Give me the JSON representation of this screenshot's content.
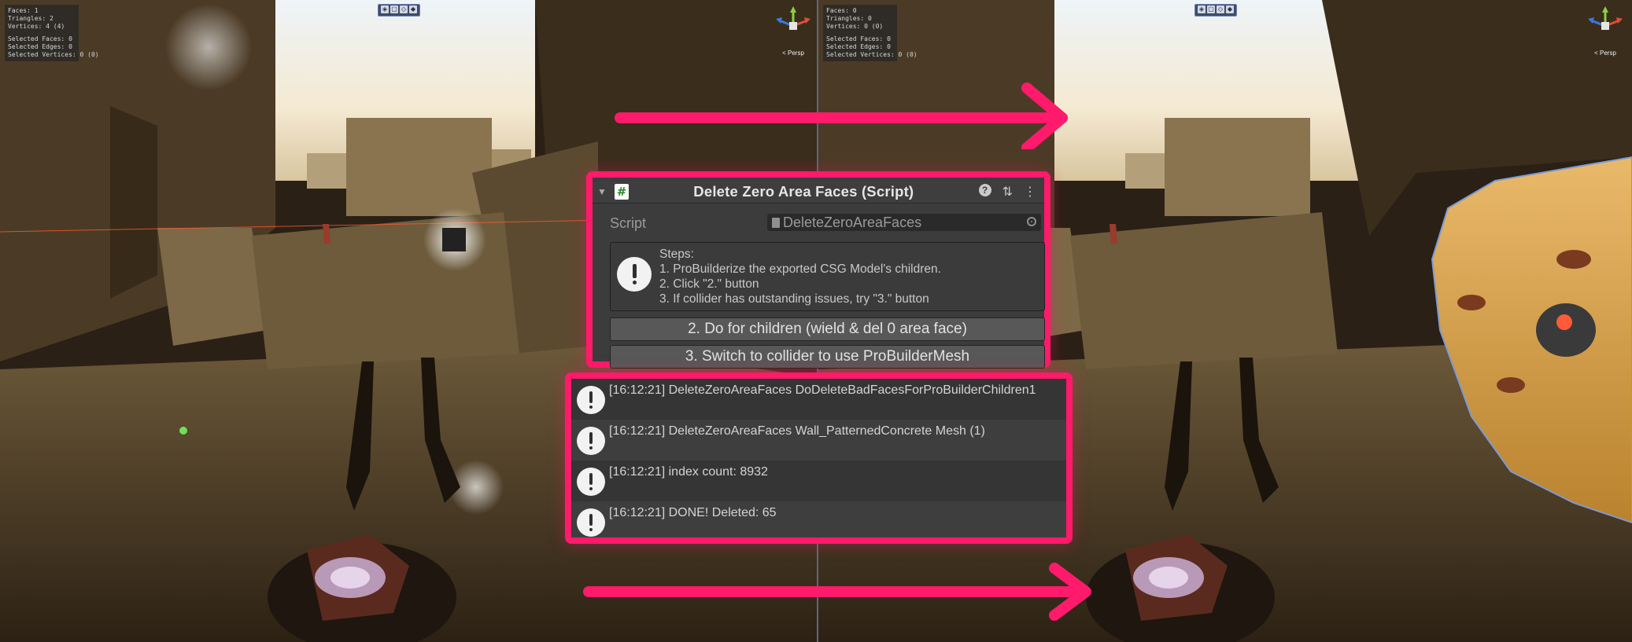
{
  "left_view": {
    "stats": {
      "faces": "Faces: 1",
      "triangles": "Triangles: 2",
      "vertices": "Vertices: 4 (4)",
      "selected_faces": "Selected Faces: 0",
      "selected_edges": "Selected Edges: 0",
      "selected_vertices": "Selected Vertices: 0 (0)"
    },
    "gizmo_label": "< Persp"
  },
  "right_view": {
    "stats": {
      "faces": "Faces: 0",
      "triangles": "Triangles: 0",
      "vertices": "Vertices: 0 (0)",
      "selected_faces": "Selected Faces: 0",
      "selected_edges": "Selected Edges: 0",
      "selected_vertices": "Selected Vertices: 0 (0)"
    },
    "gizmo_label": "< Persp"
  },
  "inspector": {
    "title": "Delete Zero Area Faces (Script)",
    "script_label": "Script",
    "script_value": "DeleteZeroAreaFaces",
    "help_lines": [
      "Steps:",
      "1. ProBuilderize the exported CSG Model's children.",
      "2. Click \"2.\" button",
      "3. If collider has outstanding issues, try \"3.\" button"
    ],
    "button_children": "2. Do for children (wield & del 0 area face)",
    "button_collider": "3. Switch to collider to use ProBuilderMesh"
  },
  "console": {
    "entries": [
      "[16:12:21] DeleteZeroAreaFaces DoDeleteBadFacesForProBuilderChildren1",
      "[16:12:21] DeleteZeroAreaFaces Wall_PatternedConcrete Mesh (1)",
      "[16:12:21] index count: 8932",
      "[16:12:21] DONE! Deleted: 65"
    ]
  },
  "icons": {
    "script": "csharp-script-icon",
    "help": "help-icon",
    "presets": "presets-icon",
    "menu": "kebab-menu-icon",
    "info": "info-icon",
    "target": "object-picker-icon",
    "arrow": "right-arrow-icon"
  },
  "colors": {
    "highlight": "#ff1a6b",
    "panel": "#3c3c3c",
    "button": "#585858"
  }
}
